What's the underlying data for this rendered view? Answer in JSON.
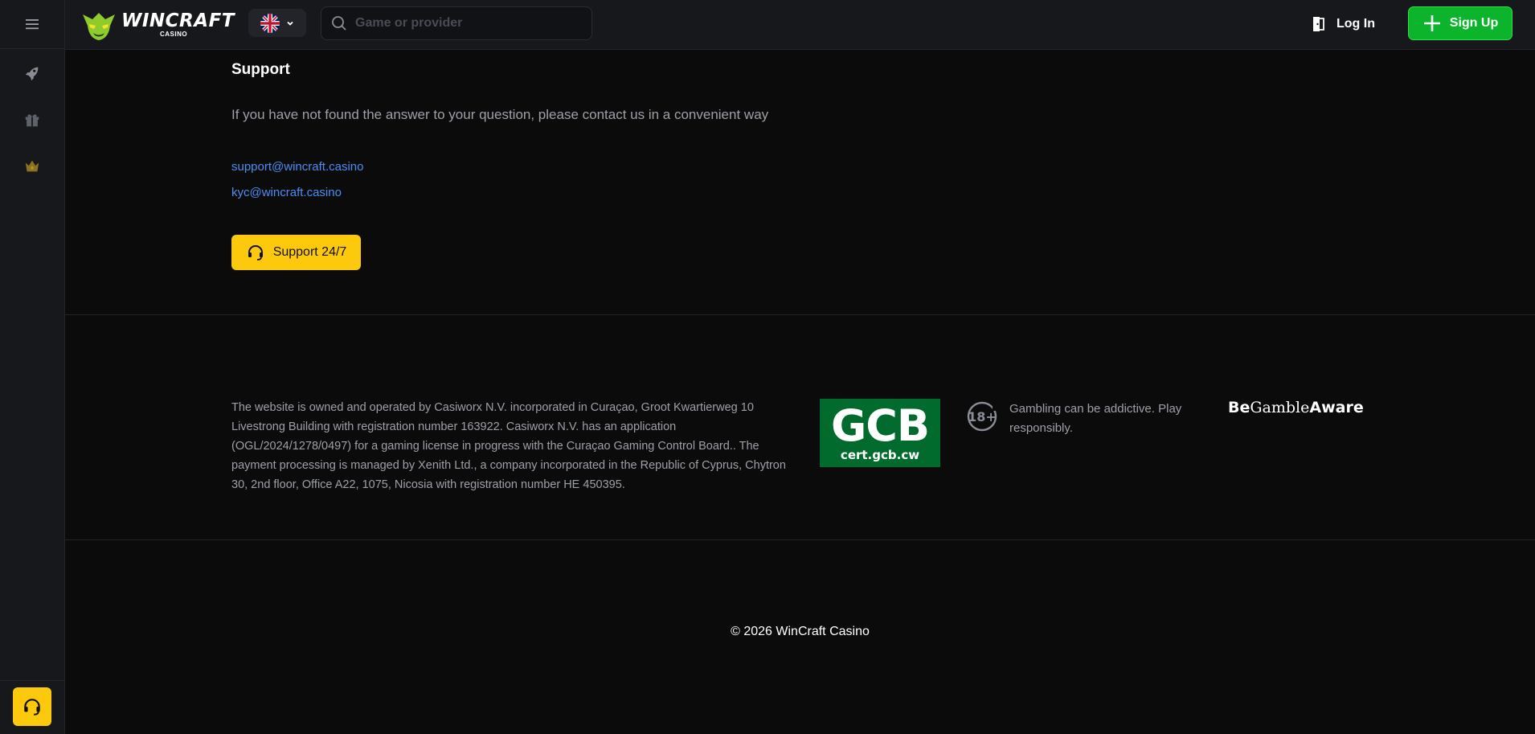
{
  "header": {
    "logo_word": "WINCRAFT",
    "logo_sub": "CASINO",
    "language": "English",
    "search_placeholder": "Game or provider",
    "login_label": "Log In",
    "signup_label": "Sign Up"
  },
  "sidebar": {
    "items": [
      {
        "icon": "menu-icon"
      },
      {
        "icon": "rocket-icon"
      },
      {
        "icon": "gift-icon"
      },
      {
        "icon": "crown-icon"
      }
    ],
    "support_icon": "headset-icon"
  },
  "support": {
    "title": "Support",
    "description": "If you have not found the answer to your question, please contact us in a convenient way",
    "emails": [
      "support@wincraft.casino",
      "kyc@wincraft.casino"
    ],
    "button_label": "Support 24/7"
  },
  "footer": {
    "legal": "The website is owned and operated by Casiworx N.V. incorporated in Curaçao, Groot Kwartierweg 10 Livestrong Building with registration number 163922. Casiworx N.V. has an application (OGL/2024/1278/0497) for a gaming license in progress with the Curaçao Gaming Control Board.. The payment processing is managed by Xenith Ltd., a company incorporated in the Republic of Cyprus, Chytron 30, 2nd floor, Office A22, 1075, Nicosia with registration number HE 450395.",
    "gcb_big": "GCB",
    "gcb_small": "cert.gcb.cw",
    "age_label": "18+",
    "age_text": "Gambling can be addictive. Play responsibly.",
    "bga_be": "Be",
    "bga_gamble": "Gamble",
    "bga_aware": "Aware",
    "copyright": "© 2026 WinCraft Casino"
  },
  "colors": {
    "accent_yellow": "#fcc90d",
    "signup_green": "#0cb42b",
    "link_blue": "#4a8ef0",
    "background": "#0b0b0c",
    "panel": "#17181c"
  }
}
